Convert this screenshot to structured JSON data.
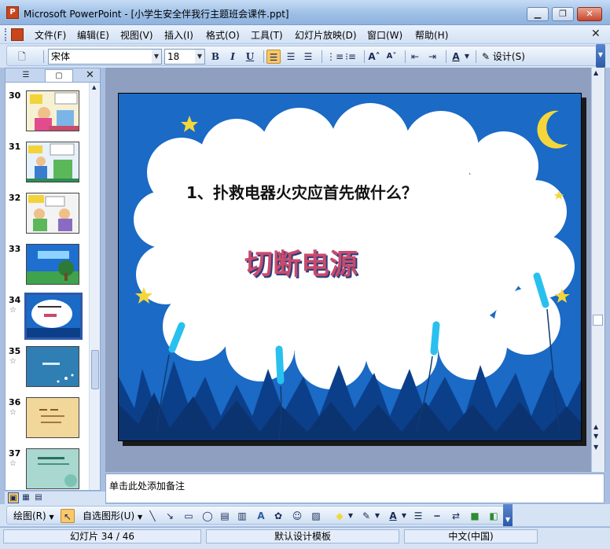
{
  "window": {
    "app_icon": "powerpoint-icon",
    "title": "Microsoft PowerPoint - [小学生安全伴我行主题班会课件.ppt]",
    "min_label": "▁",
    "max_label": "❐",
    "close_label": "✕"
  },
  "menu": {
    "items": [
      "文件(F)",
      "编辑(E)",
      "视图(V)",
      "插入(I)",
      "格式(O)",
      "工具(T)",
      "幻灯片放映(D)",
      "窗口(W)",
      "帮助(H)"
    ],
    "close_doc": "✕"
  },
  "toolbar": {
    "font_name": "宋体",
    "font_size": "18",
    "bold": "B",
    "italic": "I",
    "underline": "U",
    "design_label": "设计(S)"
  },
  "sidebar": {
    "close": "✕",
    "slides": [
      {
        "num": "30",
        "star": ""
      },
      {
        "num": "31",
        "star": ""
      },
      {
        "num": "32",
        "star": ""
      },
      {
        "num": "33",
        "star": ""
      },
      {
        "num": "34",
        "star": "☆"
      },
      {
        "num": "35",
        "star": "☆"
      },
      {
        "num": "36",
        "star": "☆"
      },
      {
        "num": "37",
        "star": "☆"
      }
    ]
  },
  "slide": {
    "question": "1、扑救电器火灾应首先做什么？",
    "answer": "切断电源",
    "colors": {
      "sky": "#1a6ac6",
      "cloud": "#ffffff",
      "grass": "#0c3f8a",
      "star": "#f5d63a",
      "reed": "#29c0ef"
    }
  },
  "notes": {
    "placeholder": "单击此处添加备注"
  },
  "drawing": {
    "draw_label": "绘图(R)",
    "autoshapes_label": "自选图形(U)"
  },
  "status": {
    "slide_pos": "幻灯片 34 / 46",
    "template": "默认设计模板",
    "language": "中文(中国)"
  }
}
